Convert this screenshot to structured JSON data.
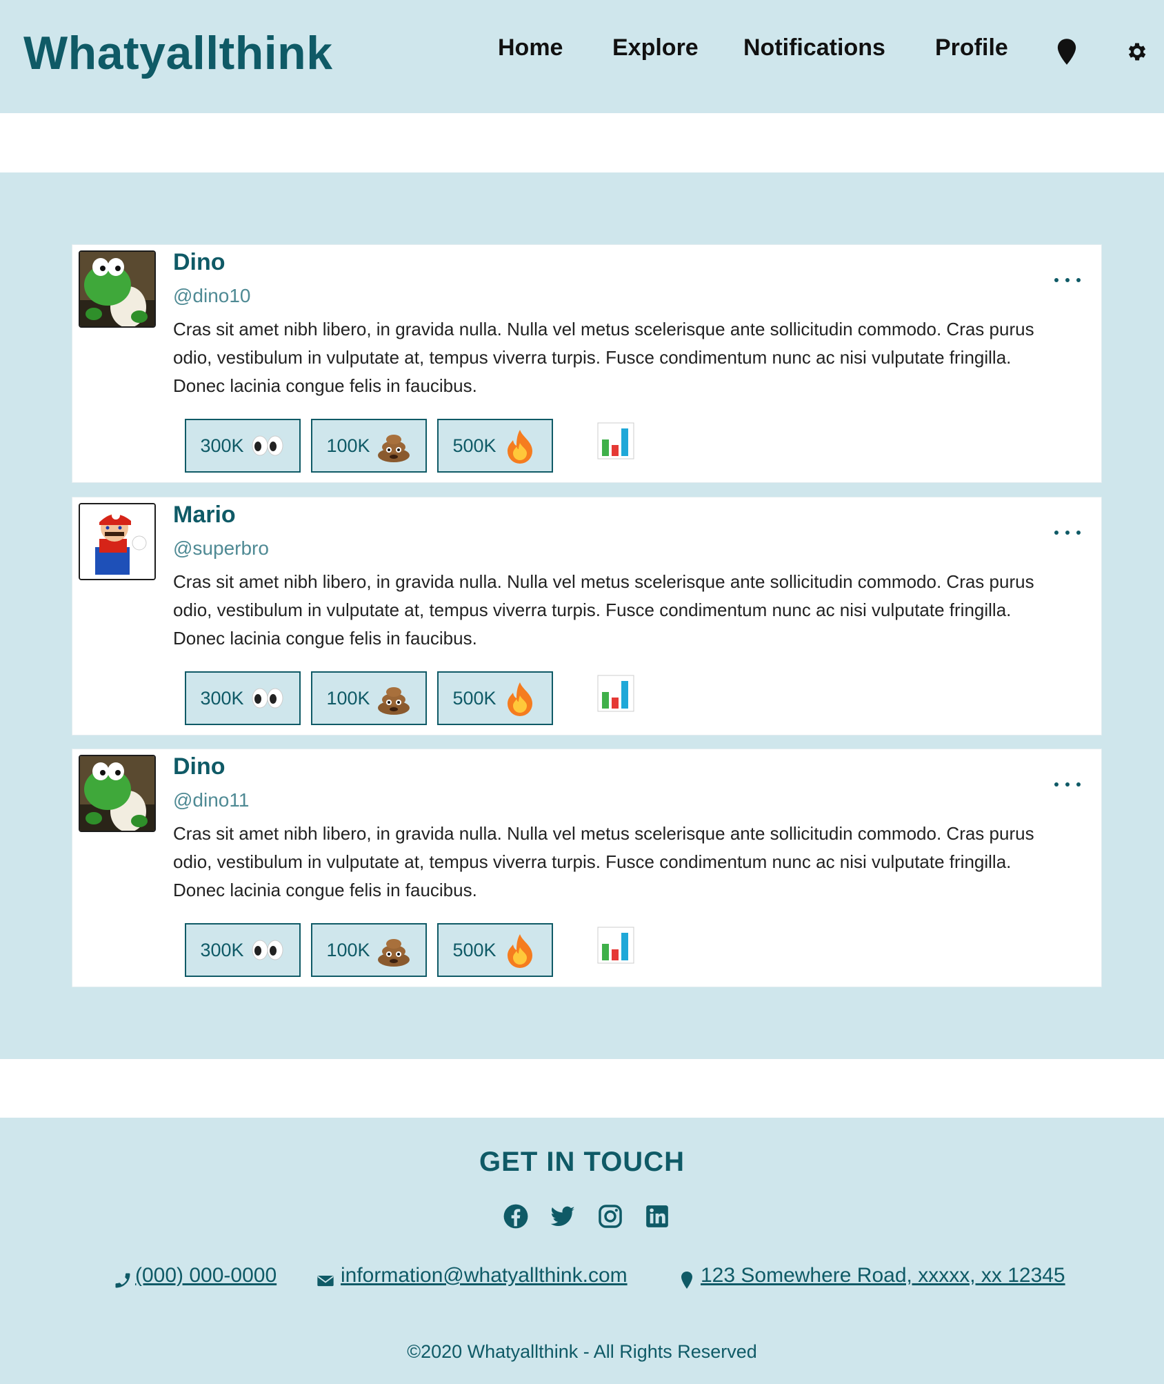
{
  "header": {
    "logo": "Whatyallthink",
    "nav": [
      "Home",
      "Explore",
      "Notifications",
      "Profile"
    ],
    "icons": [
      "map-pin-icon",
      "gear-icon"
    ],
    "colors": {
      "accent": "#0f5a66",
      "background": "#cfe6ec"
    }
  },
  "posts": [
    {
      "name": "Dino",
      "handle": "@dino10",
      "avatar": "yoshi-avatar",
      "body": "Cras sit amet nibh libero, in gravida nulla. Nulla vel metus scelerisque ante sollicitudin commodo. Cras purus odio, vestibulum in vulputate at, tempus viverra turpis. Fusce condimentum nunc ac nisi vulputate fringilla. Donec lacinia congue felis in faucibus.",
      "reactions": [
        {
          "count": "300K",
          "icon": "eyes-emoji"
        },
        {
          "count": "100K",
          "icon": "poop-emoji"
        },
        {
          "count": "500K",
          "icon": "fire-emoji"
        }
      ]
    },
    {
      "name": "Mario",
      "handle": "@superbro",
      "avatar": "mario-avatar",
      "body": "Cras sit amet nibh libero, in gravida nulla. Nulla vel metus scelerisque ante sollicitudin commodo. Cras purus odio, vestibulum in vulputate at, tempus viverra turpis. Fusce condimentum nunc ac nisi vulputate fringilla. Donec lacinia congue felis in faucibus.",
      "reactions": [
        {
          "count": "300K",
          "icon": "eyes-emoji"
        },
        {
          "count": "100K",
          "icon": "poop-emoji"
        },
        {
          "count": "500K",
          "icon": "fire-emoji"
        }
      ]
    },
    {
      "name": "Dino",
      "handle": "@dino11",
      "avatar": "yoshi-avatar",
      "body": "Cras sit amet nibh libero, in gravida nulla. Nulla vel metus scelerisque ante sollicitudin commodo. Cras purus odio, vestibulum in vulputate at, tempus viverra turpis. Fusce condimentum nunc ac nisi vulputate fringilla. Donec lacinia congue felis in faucibus.",
      "reactions": [
        {
          "count": "300K",
          "icon": "eyes-emoji"
        },
        {
          "count": "100K",
          "icon": "poop-emoji"
        },
        {
          "count": "500K",
          "icon": "fire-emoji"
        }
      ]
    }
  ],
  "footer": {
    "heading": "GET IN TOUCH",
    "social": [
      "facebook-icon",
      "twitter-icon",
      "instagram-icon",
      "linkedin-icon"
    ],
    "phone": " (000) 000-0000",
    "email": " information@whatyallthink.com",
    "address": " 123 Somewhere Road, xxxxx, xx 12345",
    "copyright": "©2020 Whatyallthink - All Rights Reserved"
  }
}
